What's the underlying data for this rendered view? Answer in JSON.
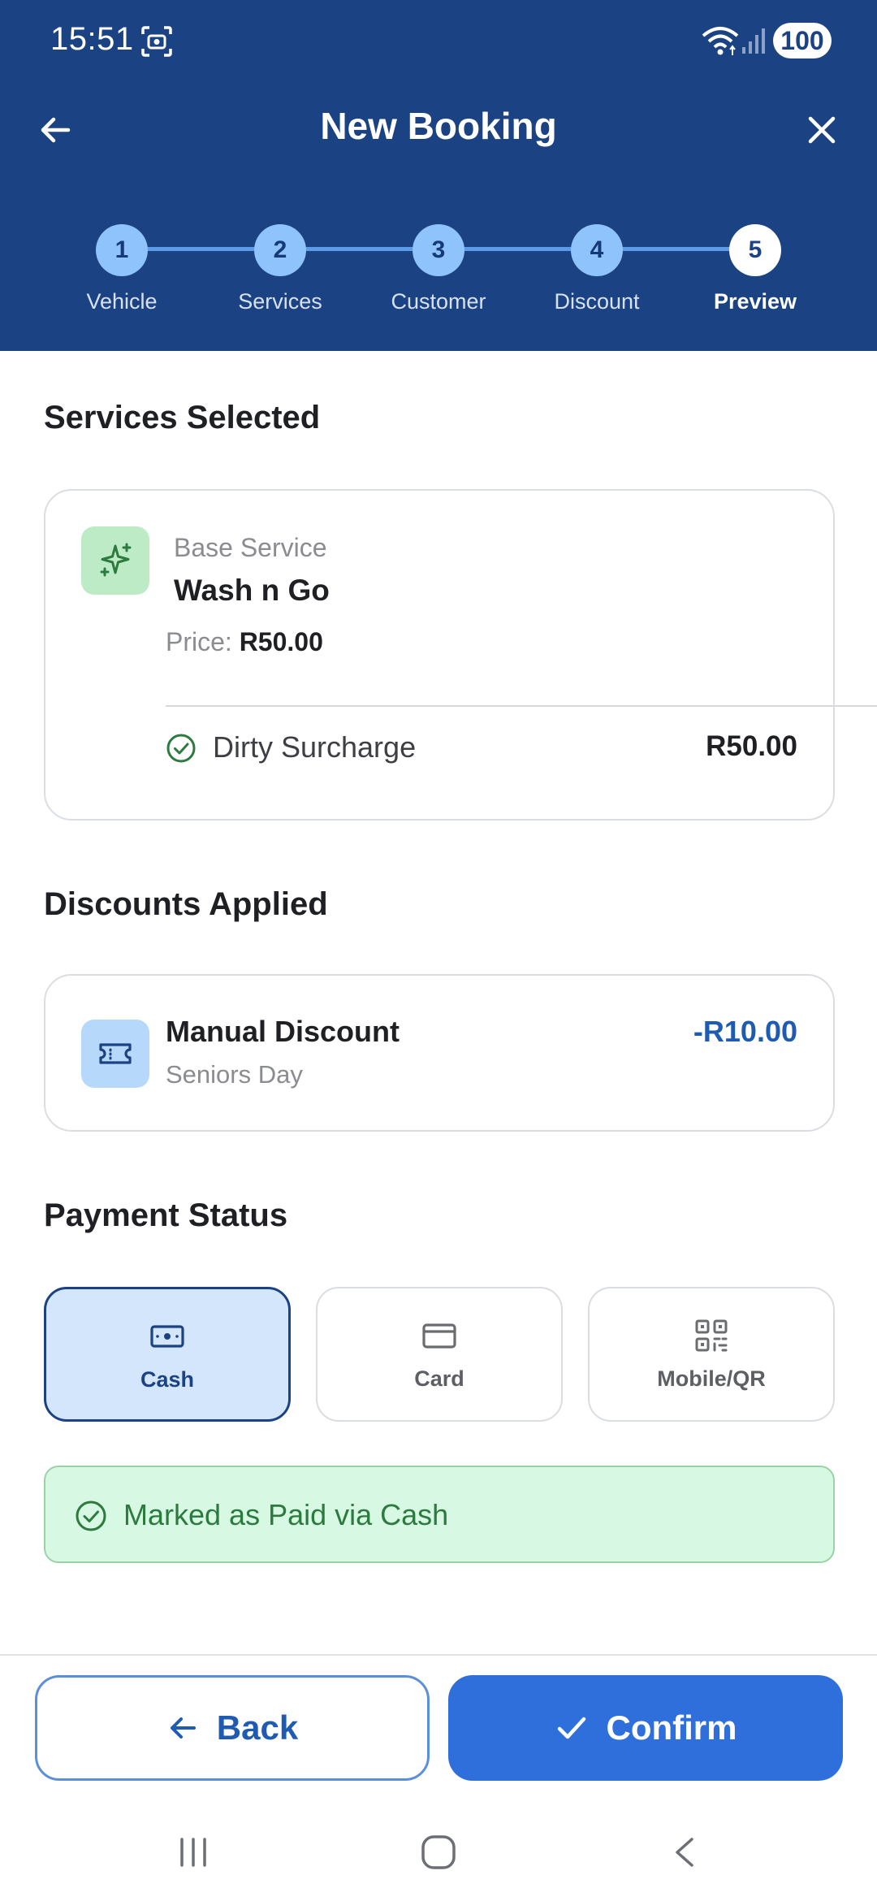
{
  "status_bar": {
    "time": "15:51",
    "battery": "100"
  },
  "header": {
    "title": "New Booking"
  },
  "stepper": {
    "steps": [
      {
        "number": "1",
        "label": "Vehicle"
      },
      {
        "number": "2",
        "label": "Services"
      },
      {
        "number": "3",
        "label": "Customer"
      },
      {
        "number": "4",
        "label": "Discount"
      },
      {
        "number": "5",
        "label": "Preview"
      }
    ],
    "active_step": 5
  },
  "services": {
    "section_title": "Services Selected",
    "base_label": "Base Service",
    "name": "Wash n Go",
    "price_label": "Price:",
    "price_value": "R50.00",
    "addons": [
      {
        "name": "Dirty Surcharge",
        "price": "R50.00"
      }
    ]
  },
  "discounts": {
    "section_title": "Discounts Applied",
    "items": [
      {
        "title": "Manual Discount",
        "subtitle": "Seniors Day",
        "amount": "-R10.00"
      }
    ]
  },
  "payment": {
    "section_title": "Payment Status",
    "options": [
      {
        "label": "Cash",
        "icon": "cash-icon",
        "selected": true
      },
      {
        "label": "Card",
        "icon": "card-icon",
        "selected": false
      },
      {
        "label": "Mobile/QR",
        "icon": "qr-code-icon",
        "selected": false
      }
    ],
    "status_text": "Marked as Paid via Cash"
  },
  "actions": {
    "back_label": "Back",
    "confirm_label": "Confirm"
  },
  "colors": {
    "header_bg": "#1b4282",
    "accent": "#2f6fdc",
    "success_bg": "#d7f8e3",
    "success_text": "#2d7a3e",
    "discount_text": "#1f5bb0"
  }
}
